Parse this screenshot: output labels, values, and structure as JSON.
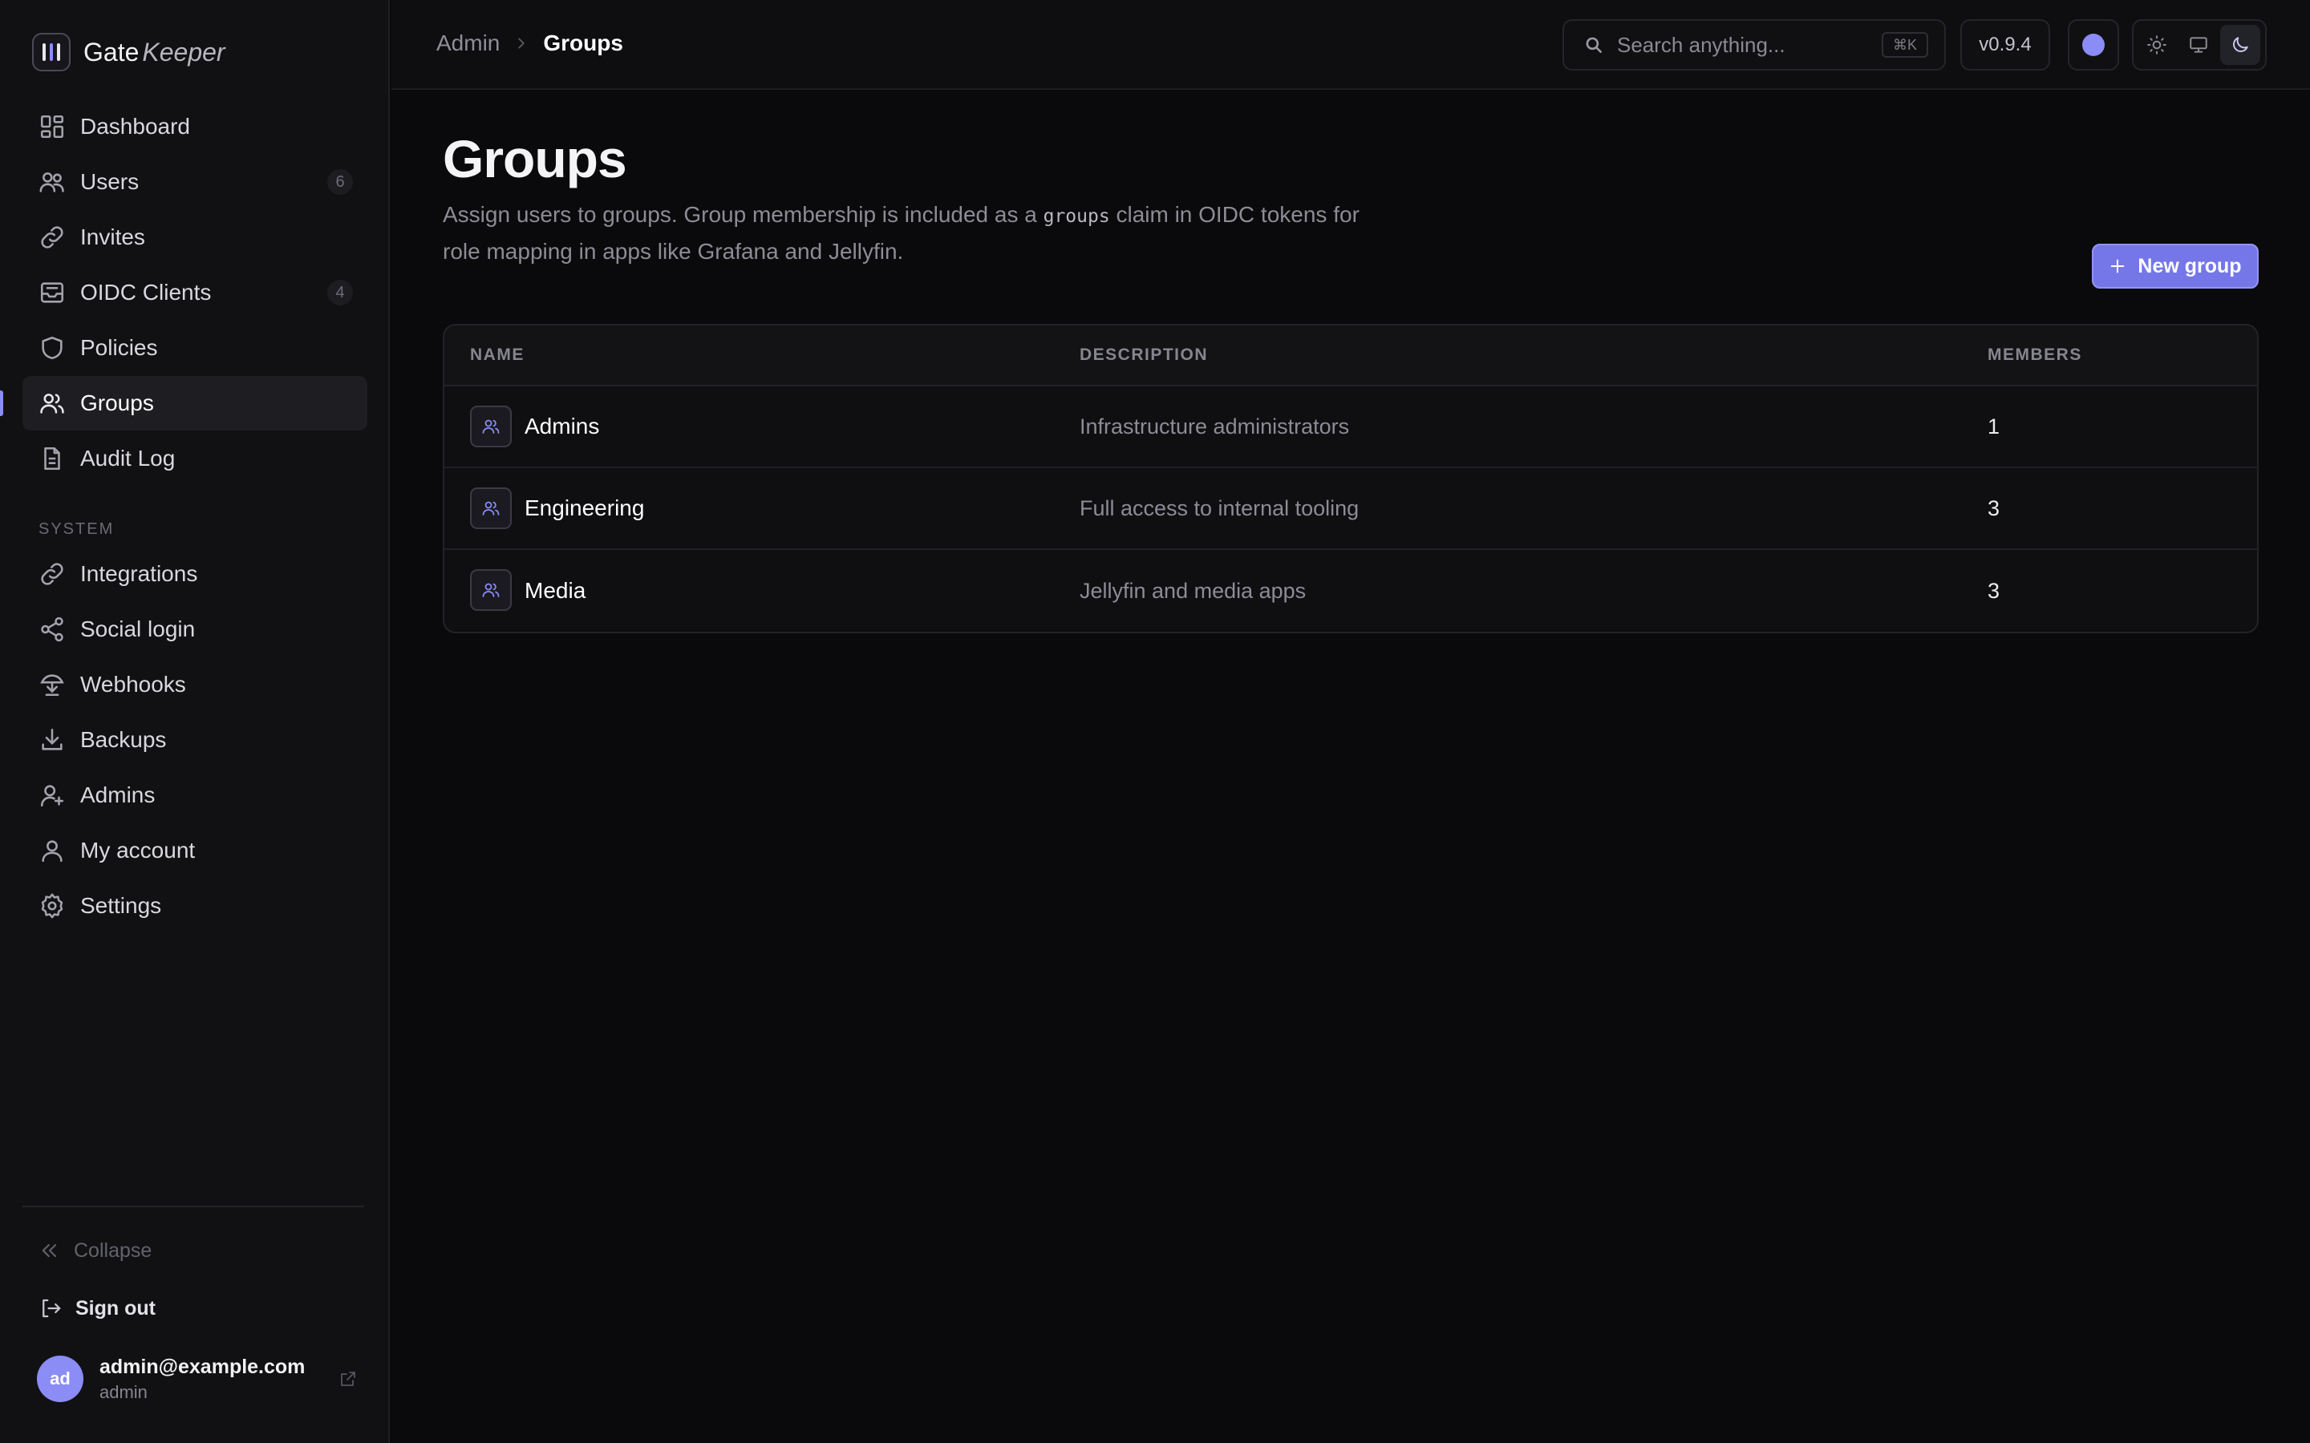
{
  "app": {
    "name_part1": "Gate",
    "name_part2": "Keeper"
  },
  "sidebar": {
    "items": [
      {
        "label": "Dashboard",
        "icon": "dashboard-icon"
      },
      {
        "label": "Users",
        "icon": "users-icon",
        "badge": "6"
      },
      {
        "label": "Invites",
        "icon": "link-icon"
      },
      {
        "label": "OIDC Clients",
        "icon": "inbox-icon",
        "badge": "4"
      },
      {
        "label": "Policies",
        "icon": "shield-icon"
      },
      {
        "label": "Groups",
        "icon": "groups-icon",
        "active": true
      },
      {
        "label": "Audit Log",
        "icon": "document-icon"
      }
    ],
    "section_label": "SYSTEM",
    "system_items": [
      {
        "label": "Integrations",
        "icon": "link-icon"
      },
      {
        "label": "Social login",
        "icon": "share-icon"
      },
      {
        "label": "Webhooks",
        "icon": "webhook-icon"
      },
      {
        "label": "Backups",
        "icon": "download-icon"
      },
      {
        "label": "Admins",
        "icon": "user-plus-icon"
      },
      {
        "label": "My account",
        "icon": "user-icon"
      },
      {
        "label": "Settings",
        "icon": "gear-icon"
      }
    ],
    "collapse_label": "Collapse",
    "signout_label": "Sign out",
    "user": {
      "initials": "ad",
      "email": "admin@example.com",
      "role": "admin"
    }
  },
  "topbar": {
    "breadcrumb": [
      "Admin",
      "Groups"
    ],
    "search_placeholder": "Search anything...",
    "search_shortcut": "⌘K",
    "version": "v0.9.4",
    "accent_color": "#8b8cf5",
    "theme_options": [
      "light",
      "system",
      "dark"
    ],
    "theme_selected": "dark"
  },
  "main": {
    "title": "Groups",
    "description_before": "Assign users to groups. Group membership is included as a ",
    "description_code": "groups",
    "description_after": " claim in OIDC tokens for role mapping in apps like Grafana and Jellyfin.",
    "new_button": "New group",
    "table": {
      "columns": [
        "NAME",
        "DESCRIPTION",
        "MEMBERS"
      ],
      "rows": [
        {
          "name": "Admins",
          "description": "Infrastructure administrators",
          "members": "1"
        },
        {
          "name": "Engineering",
          "description": "Full access to internal tooling",
          "members": "3"
        },
        {
          "name": "Media",
          "description": "Jellyfin and media apps",
          "members": "3"
        }
      ]
    }
  }
}
